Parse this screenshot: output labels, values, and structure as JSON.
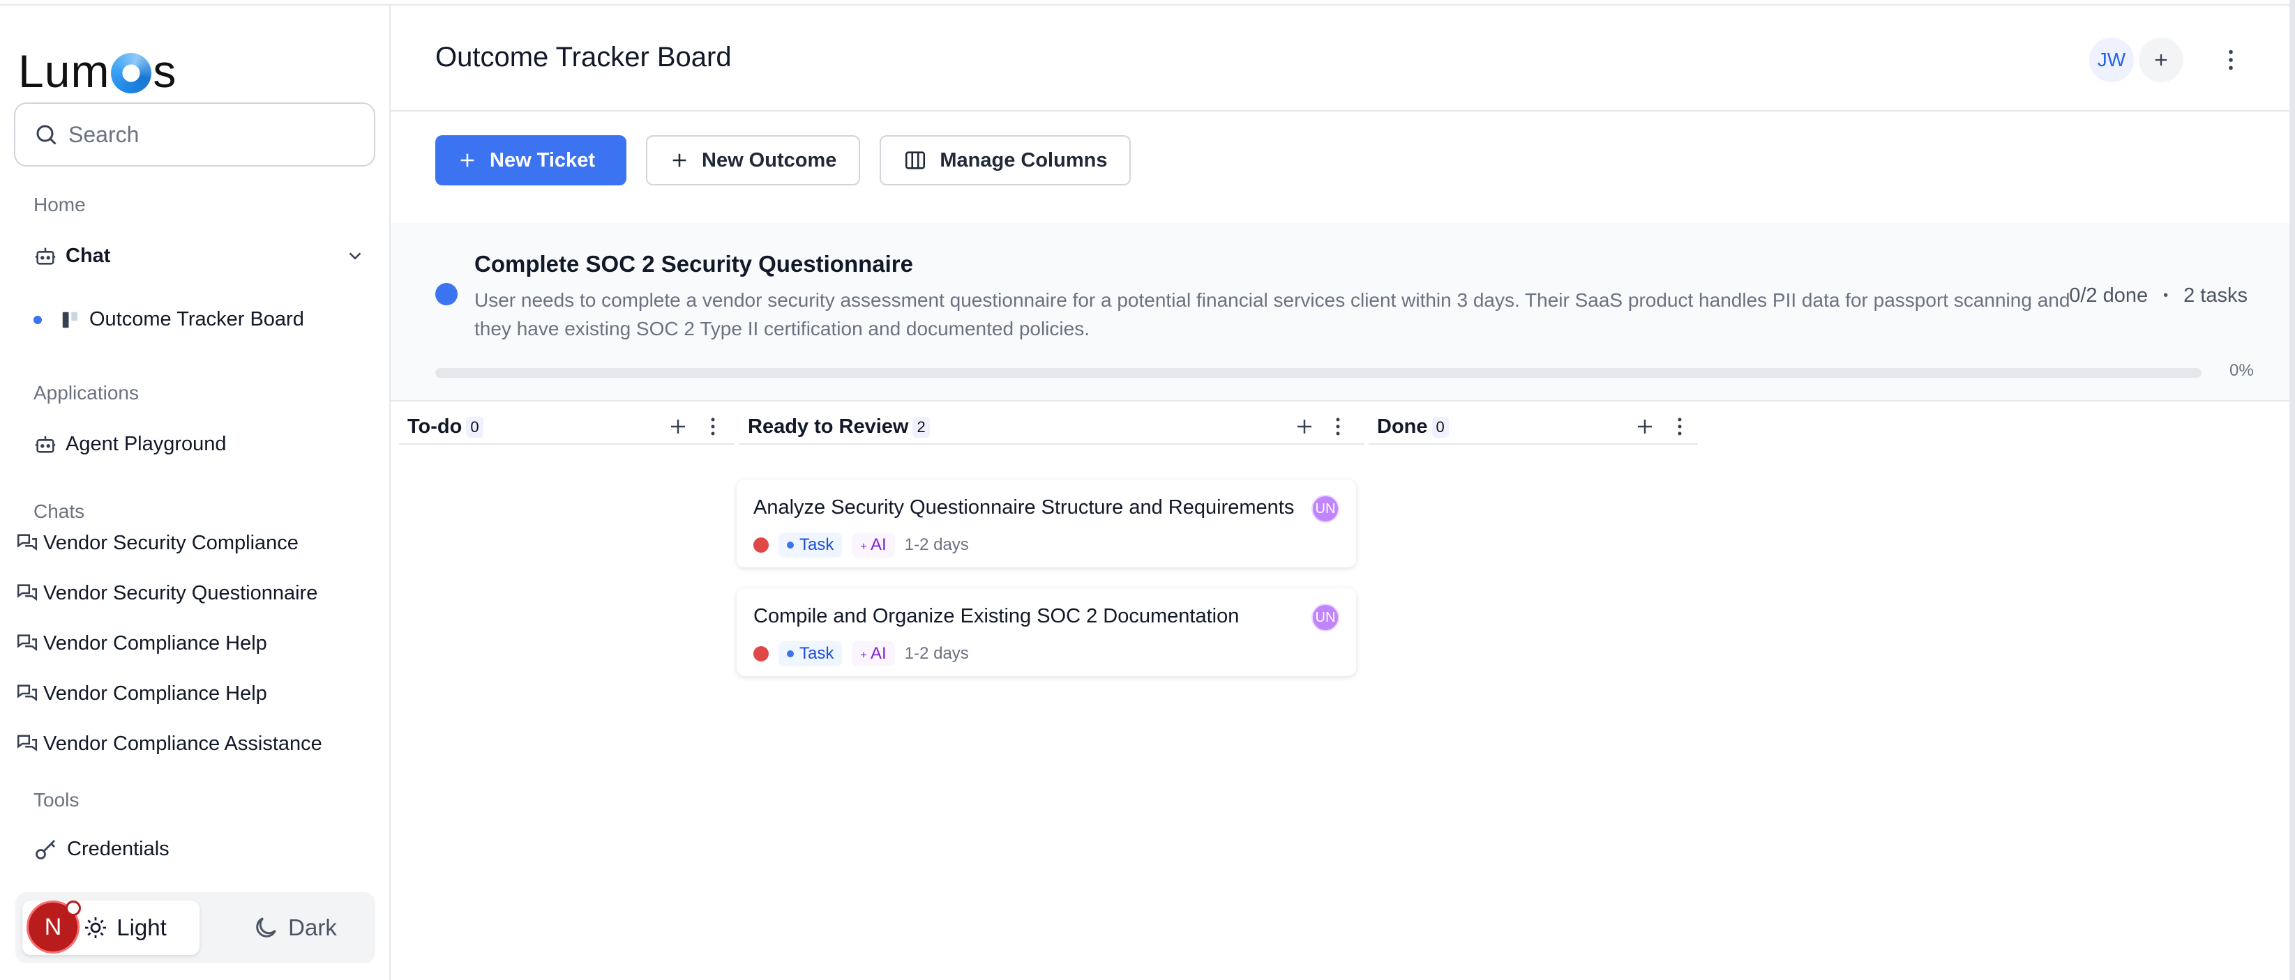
{
  "sidebar": {
    "logo": "Lumos",
    "search_placeholder": "Search",
    "home_label": "Home",
    "chat_label": "Chat",
    "outcome_board_label": "Outcome Tracker Board",
    "applications_label": "Applications",
    "agent_playground_label": "Agent Playground",
    "chats_label": "Chats",
    "chats": [
      "Vendor Security Compliance",
      "Vendor Security Questionnaire",
      "Vendor Compliance Help",
      "Vendor Compliance Help",
      "Vendor Compliance Assistance"
    ],
    "tools_label": "Tools",
    "credentials_label": "Credentials",
    "theme_light": "Light",
    "theme_dark": "Dark",
    "user_initial": "N"
  },
  "header": {
    "title": "Outcome Tracker Board",
    "member_initials": "JW"
  },
  "toolbar": {
    "new_ticket": "New Ticket",
    "new_outcome": "New Outcome",
    "manage_columns": "Manage Columns"
  },
  "outcome": {
    "title": "Complete SOC 2 Security Questionnaire",
    "description": "User needs to complete a vendor security assessment questionnaire for a potential financial services client within 3 days. Their SaaS product handles PII data for passport scanning and they have existing SOC 2 Type II certification and documented policies.",
    "done": "0/2 done",
    "separator": "•",
    "tasks": "2 tasks",
    "progress_label": "0%",
    "progress": 0
  },
  "columns": [
    {
      "title": "To-do",
      "count": "0"
    },
    {
      "title": "Ready to Review",
      "count": "2"
    },
    {
      "title": "Done",
      "count": "0"
    }
  ],
  "cards": [
    {
      "title": "Analyze Security Questionnaire Structure and Requirements",
      "assignee": "UN",
      "type": "Task",
      "ai": "AI",
      "duration": "1-2 days"
    },
    {
      "title": "Compile and Organize Existing SOC 2 Documentation",
      "assignee": "UN",
      "type": "Task",
      "ai": "AI",
      "duration": "1-2 days"
    }
  ],
  "colors": {
    "accent": "#3b73f0",
    "priority_high": "#e04848"
  }
}
